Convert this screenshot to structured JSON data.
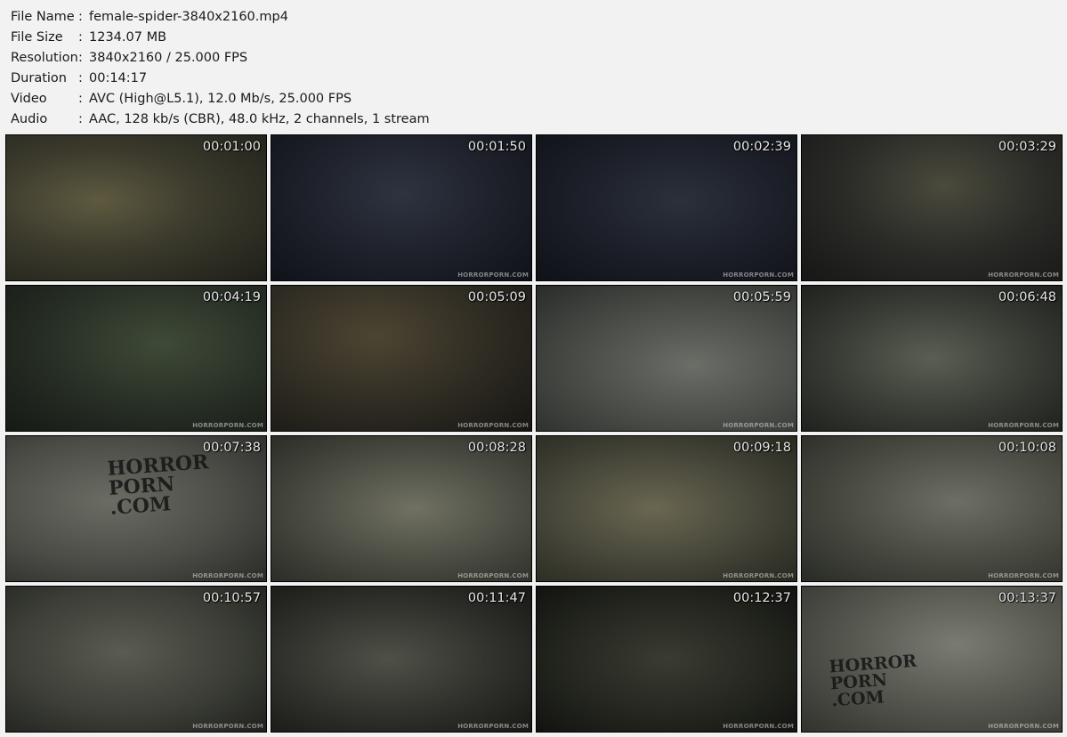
{
  "info": {
    "separator": ":",
    "rows": [
      {
        "key": "File Name",
        "value": "female-spider-3840x2160.mp4"
      },
      {
        "key": "File Size",
        "value": "1234.07 MB"
      },
      {
        "key": "Resolution",
        "value": "3840x2160 / 25.000 FPS"
      },
      {
        "key": "Duration",
        "value": "00:14:17"
      },
      {
        "key": "Video",
        "value": "AVC (High@L5.1), 12.0 Mb/s, 25.000 FPS"
      },
      {
        "key": "Audio",
        "value": "AAC, 128 kb/s (CBR), 48.0 kHz, 2 channels, 1 stream"
      }
    ]
  },
  "watermark": "HORRORPORN.COM",
  "graffiti": {
    "line1": "HORROR",
    "line2": "PORN",
    "line3": ".COM"
  },
  "thumbnails": [
    {
      "time": "00:01:00",
      "watermark": false
    },
    {
      "time": "00:01:50",
      "watermark": true
    },
    {
      "time": "00:02:39",
      "watermark": true
    },
    {
      "time": "00:03:29",
      "watermark": true
    },
    {
      "time": "00:04:19",
      "watermark": true
    },
    {
      "time": "00:05:09",
      "watermark": true
    },
    {
      "time": "00:05:59",
      "watermark": true
    },
    {
      "time": "00:06:48",
      "watermark": true
    },
    {
      "time": "00:07:38",
      "watermark": true
    },
    {
      "time": "00:08:28",
      "watermark": true
    },
    {
      "time": "00:09:18",
      "watermark": true
    },
    {
      "time": "00:10:08",
      "watermark": true
    },
    {
      "time": "00:10:57",
      "watermark": true
    },
    {
      "time": "00:11:47",
      "watermark": true
    },
    {
      "time": "00:12:37",
      "watermark": true
    },
    {
      "time": "00:13:37",
      "watermark": true
    }
  ]
}
